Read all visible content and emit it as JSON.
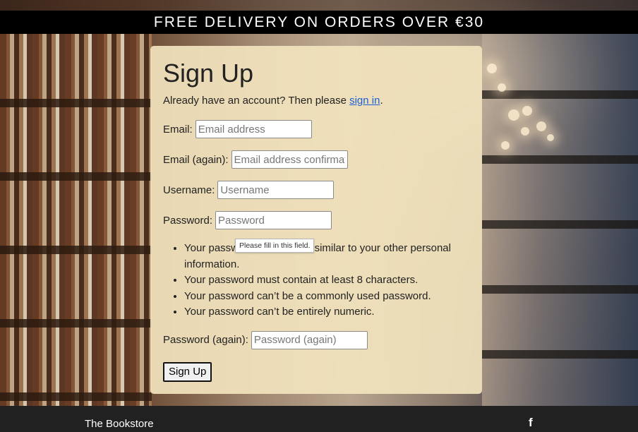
{
  "banner": {
    "text": "FREE DELIVERY ON ORDERS OVER €30"
  },
  "signup": {
    "title": "Sign Up",
    "intro_prefix": "Already have an account? Then please ",
    "intro_link": "sign in",
    "intro_suffix": ".",
    "fields": {
      "email": {
        "label": "Email:",
        "placeholder": "Email address",
        "value": ""
      },
      "email2": {
        "label": "Email (again):",
        "placeholder": "Email address confirmation",
        "value": ""
      },
      "username": {
        "label": "Username:",
        "placeholder": "Username",
        "value": ""
      },
      "password": {
        "label": "Password:",
        "placeholder": "Password",
        "value": ""
      },
      "password2": {
        "label": "Password (again):",
        "placeholder": "Password (again)",
        "value": ""
      }
    },
    "password_rules": [
      "Your password can’t be too similar to your other personal information.",
      "Your password must contain at least 8 characters.",
      "Your password can’t be a commonly used password.",
      "Your password can’t be entirely numeric."
    ],
    "tooltip": "Please fill in this field.",
    "submit_label": "Sign Up"
  },
  "footer": {
    "brand": "The Bookstore",
    "social_icon": "facebook-icon",
    "social_glyph": "f"
  }
}
